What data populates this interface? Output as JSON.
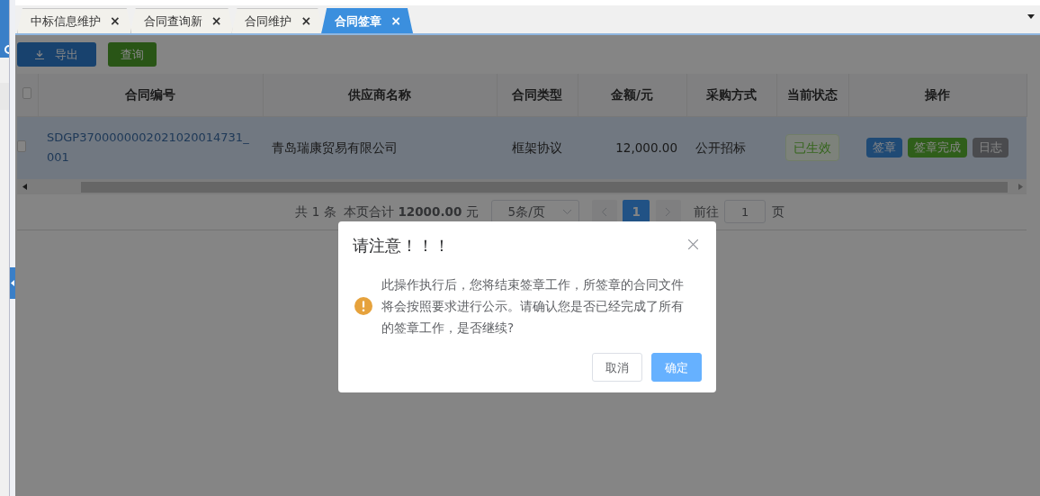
{
  "tabs": [
    {
      "label": "中标信息维护",
      "selected": false,
      "close": "×"
    },
    {
      "label": "合同查询新",
      "selected": false,
      "close": "×"
    },
    {
      "label": "合同维护",
      "selected": false,
      "close": "×"
    },
    {
      "label": "合同签章",
      "selected": true,
      "close": "×"
    }
  ],
  "toolbar": [
    {
      "label": "导出",
      "kind": "export"
    },
    {
      "label": "查询",
      "kind": "query"
    }
  ],
  "table": {
    "columns": [
      "合同编号",
      "供应商名称",
      "合同类型",
      "金额/元",
      "采购方式",
      "当前状态",
      "操作"
    ],
    "header_checked": false,
    "rows": [
      {
        "selected": true,
        "checked": false,
        "contract_no": "SDGP3700000002021020014731_001",
        "supplier": "青岛瑞康贸易有限公司",
        "type": "框架协议",
        "amount": "12,000.00",
        "method": "公开招标",
        "status": "已生效",
        "actions": [
          {
            "label": "签章",
            "kind": "sign"
          },
          {
            "label": "签章完成",
            "kind": "complete"
          },
          {
            "label": "日志",
            "kind": "log"
          }
        ]
      }
    ]
  },
  "pagination": {
    "summary": "共 1 条  本页合计 **12000.00** 元",
    "page_size": "5条/页",
    "pages": [
      {
        "label": "1",
        "selected": true
      }
    ],
    "goto_label": "前往",
    "goto_value": "1",
    "goto_suffix": "页"
  },
  "dialog": {
    "title": "请注意！！！",
    "message": "此操作执行后，您将结束签章工作，所签章的合同文件将会按照要求进行公示。请确认您是否已经完成了所有的签章工作，是否继续?",
    "buttons": [
      {
        "label": "取消",
        "kind": "secondary"
      },
      {
        "label": "确定",
        "kind": "primary"
      }
    ]
  }
}
